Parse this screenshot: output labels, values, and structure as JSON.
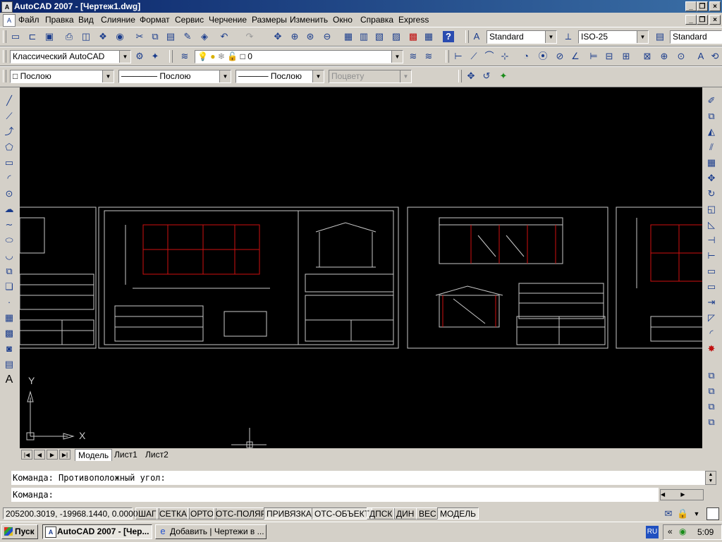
{
  "window": {
    "title": "AutoCAD 2007 - [Чертеж1.dwg]"
  },
  "menu": [
    "Файл",
    "Правка",
    "Вид",
    "Слияние",
    "Формат",
    "Сервис",
    "Черчение",
    "Размеры",
    "Изменить",
    "Окно",
    "Справка",
    "Express"
  ],
  "toolbar": {
    "text_style": "Standard",
    "dim_style": "ISO-25",
    "table_style": "Standard",
    "workspace": "Классический AutoCAD",
    "layer": "0",
    "color": "Послою",
    "linetype": "Послою",
    "lineweight": "Послою",
    "plotstyle": "Поцвету"
  },
  "ucs": {
    "x_label": "X",
    "y_label": "Y"
  },
  "tabs": [
    "Модель",
    "Лист1",
    "Лист2"
  ],
  "command": {
    "history": "Команда: Противоположный угол:",
    "prompt": "Команда:"
  },
  "status": {
    "coords": "205200.3019, -19968.1440, 0.0000",
    "toggles": [
      "ШАГ",
      "СЕТКА",
      "ОРТО",
      "ОТС-ПОЛЯР",
      "ПРИВЯЗКА",
      "ОТС-ОБЪЕКТ",
      "ДПСК",
      "ДИН",
      "ВЕС",
      "МОДЕЛЬ"
    ]
  },
  "taskbar": {
    "start": "Пуск",
    "tasks": [
      "AutoCAD 2007 - [Чер...",
      "Добавить | Чертежи в ..."
    ],
    "lang": "RU",
    "time": "5:09"
  },
  "colors": {
    "title_start": "#0a246a",
    "title_end": "#3a6ea5",
    "canvas": "#000000",
    "sheet_line": "#c8c8c8",
    "accent_red": "#d01010"
  }
}
